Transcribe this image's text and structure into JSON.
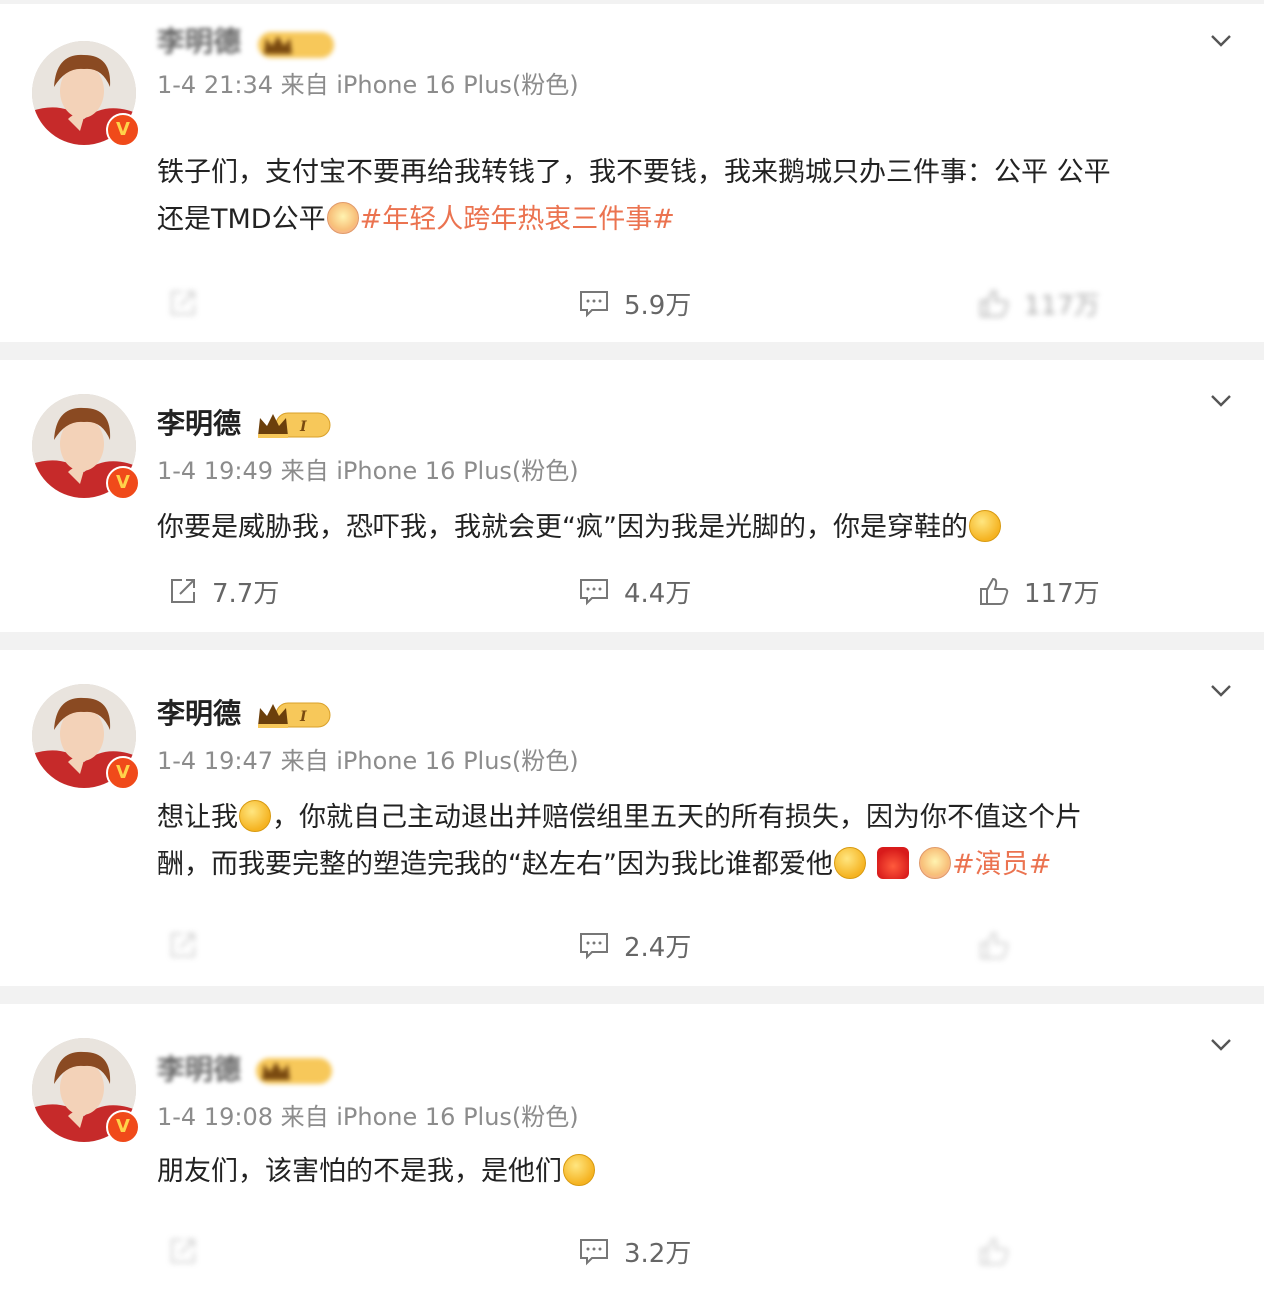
{
  "posts": [
    {
      "name": "李明德",
      "time": "1-4 21:34",
      "source": "来自 iPhone 16 Plus(粉色)",
      "text_lines": [
        "铁子们，支付宝不要再给我转钱了，我不要钱，我来鹅城只办三件事：公平 公平",
        "还是TMD公平"
      ],
      "hashtag": "#年轻人跨年热衷三件事#",
      "repost": "",
      "comments": "5.9万",
      "likes": "117万"
    },
    {
      "name": "李明德",
      "time": "1-4 19:49",
      "source": "来自 iPhone 16 Plus(粉色)",
      "text_lines": [
        "你要是威胁我，恐吓我，我就会更“疯”因为我是光脚的，你是穿鞋的"
      ],
      "repost": "7.7万",
      "comments": "4.4万",
      "likes": "117万"
    },
    {
      "name": "李明德",
      "time": "1-4 19:47",
      "source": "来自 iPhone 16 Plus(粉色)",
      "text_lines": [
        "想让我",
        "，你就自己主动退出并赔偿组里五天的所有损失，因为你不值这个片",
        "酬，而我要完整的塑造完我的“赵左右”因为我比谁都爱他"
      ],
      "hashtag": "#演员#",
      "repost": "",
      "comments": "2.4万",
      "likes": ""
    },
    {
      "name": "李明德",
      "time": "1-4 19:08",
      "source": "来自 iPhone 16 Plus(粉色)",
      "text_lines": [
        "朋友们，该害怕的不是我，是他们"
      ],
      "repost": "",
      "comments": "3.2万",
      "likes": ""
    }
  ],
  "icons": {
    "more": "chevron-down-icon",
    "repost": "share-icon",
    "comment": "comment-icon",
    "like": "thumbs-up-icon",
    "verified": "verified-v-icon",
    "vip": "crown-icon"
  },
  "colors": {
    "hashtag": "#eb7350",
    "meta": "#8c8c8c",
    "badge": "#f04a1a",
    "background": "#f2f2f2"
  }
}
